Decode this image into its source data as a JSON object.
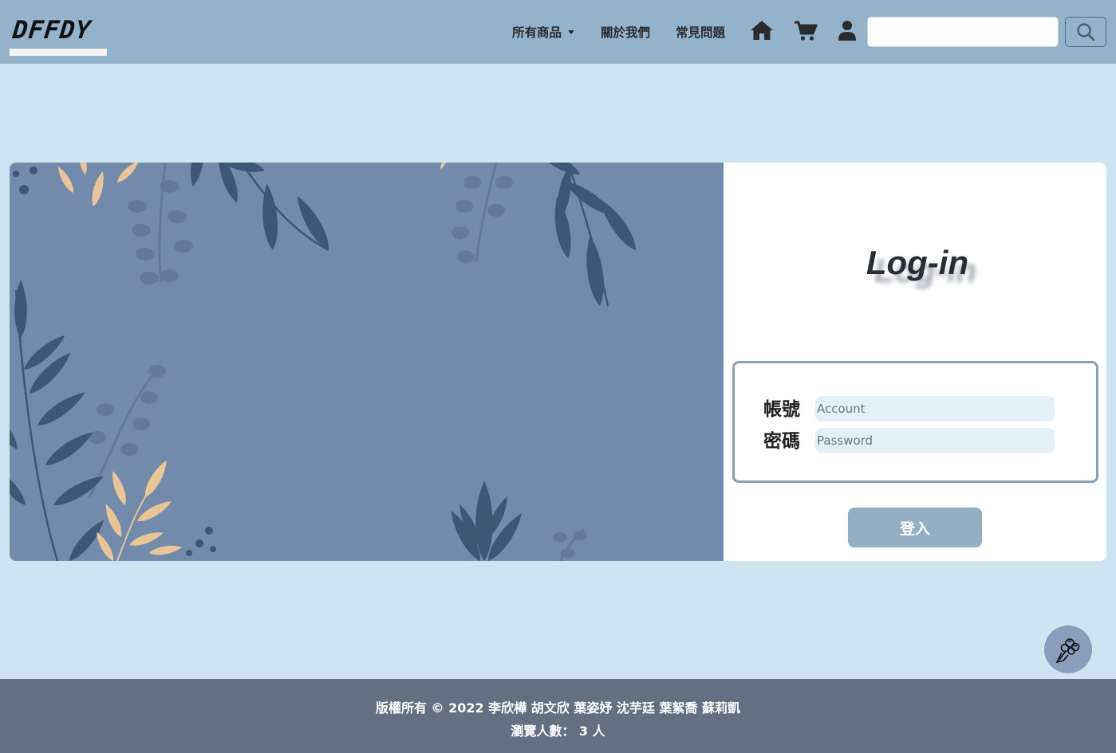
{
  "brand": {
    "logo_text": "DFFDY"
  },
  "nav": {
    "items": [
      {
        "label": "所有商品",
        "has_dropdown": true
      },
      {
        "label": "關於我們"
      },
      {
        "label": "常見問題"
      }
    ],
    "icons": [
      "home-icon",
      "cart-icon",
      "user-icon"
    ],
    "search": {
      "value": "",
      "button_icon": "search-icon"
    }
  },
  "login": {
    "title": "Log-in",
    "account_label": "帳號",
    "account_placeholder": "Account",
    "password_label": "密碼",
    "password_placeholder": "Password",
    "submit_label": "登入"
  },
  "float_button": {
    "icon": "bouquet-icon"
  },
  "footer": {
    "copyright": "版權所有 © 2022 李欣樺 胡文欣 葉姿妤 沈芋廷 葉絮喬 蘇莉凱",
    "visitors": "瀏覽人數： 3 人"
  },
  "colors": {
    "navbar": "#93b2cb",
    "page_background": "#cfe4f1",
    "banner": "#728aac",
    "leaf_dark": "#3d5876",
    "leaf_light": "#e9c495",
    "footer": "#646f80",
    "button": "#93afc6"
  }
}
